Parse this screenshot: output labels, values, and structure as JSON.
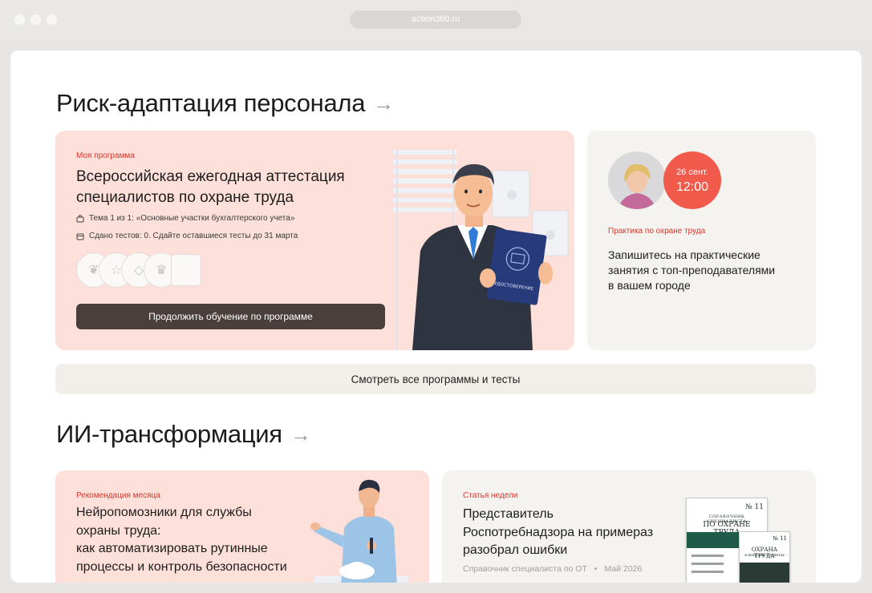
{
  "browser": {
    "url": "action360.ru"
  },
  "sections": {
    "risk": {
      "title": "Риск-адаптация персонала"
    },
    "ai": {
      "title": "ИИ-трансформация"
    }
  },
  "program_card": {
    "tag": "Моя программа",
    "title_line1": "Всероссийская ежегодная аттестация",
    "title_line2": "специалистов по охране труда",
    "topic": "Тема 1 из 1: «Основные участки бухгалтерского учета»",
    "tests": "Сдано тестов: 0. Сдайте оставшиеся тесты до 31 марта",
    "continue_label": "Продолжить обучение по программе",
    "certificate_label": "УДОСТОВЕРЕНИЕ"
  },
  "practice_card": {
    "date": "26 сент.",
    "time": "12:00",
    "tag": "Практика по охране труда",
    "title_line1": "Запишитесь на практические",
    "title_line2": "занятия с топ-преподавателями",
    "title_line3": "в вашем городе"
  },
  "see_all_label": "Смотреть все программы и тесты",
  "recommendation_card": {
    "tag": "Рекомендация месяца",
    "title_line1": "Нейропомозники для службы",
    "title_line2": "охраны труда:",
    "title_line3": "как автоматизировать рутинные",
    "title_line4": "процессы и контроль безопасности"
  },
  "article_card": {
    "tag": "Статья недели",
    "title_line1": "Представитель",
    "title_line2": "Роспотребнадзора на примераз",
    "title_line3": "разобрал ошибки",
    "source": "Справочник специалиста по ОТ",
    "separator": "•",
    "date": "Май 2026"
  },
  "magazines": {
    "issue": "№ 11",
    "back_title": "ПО ОХРАНЕ ТРУДА",
    "back_supertitle": "СПРАВОЧНИК СПЕЦИАЛИСТА",
    "front_title": "ОХРАНА ТРУДА",
    "front_subtitle": "в вопросах и ответах"
  },
  "colors": {
    "accent": "#f25b4b",
    "pink_card": "#fde0d9",
    "beige_card": "#f5f3ef",
    "button": "#4a3f3d"
  }
}
